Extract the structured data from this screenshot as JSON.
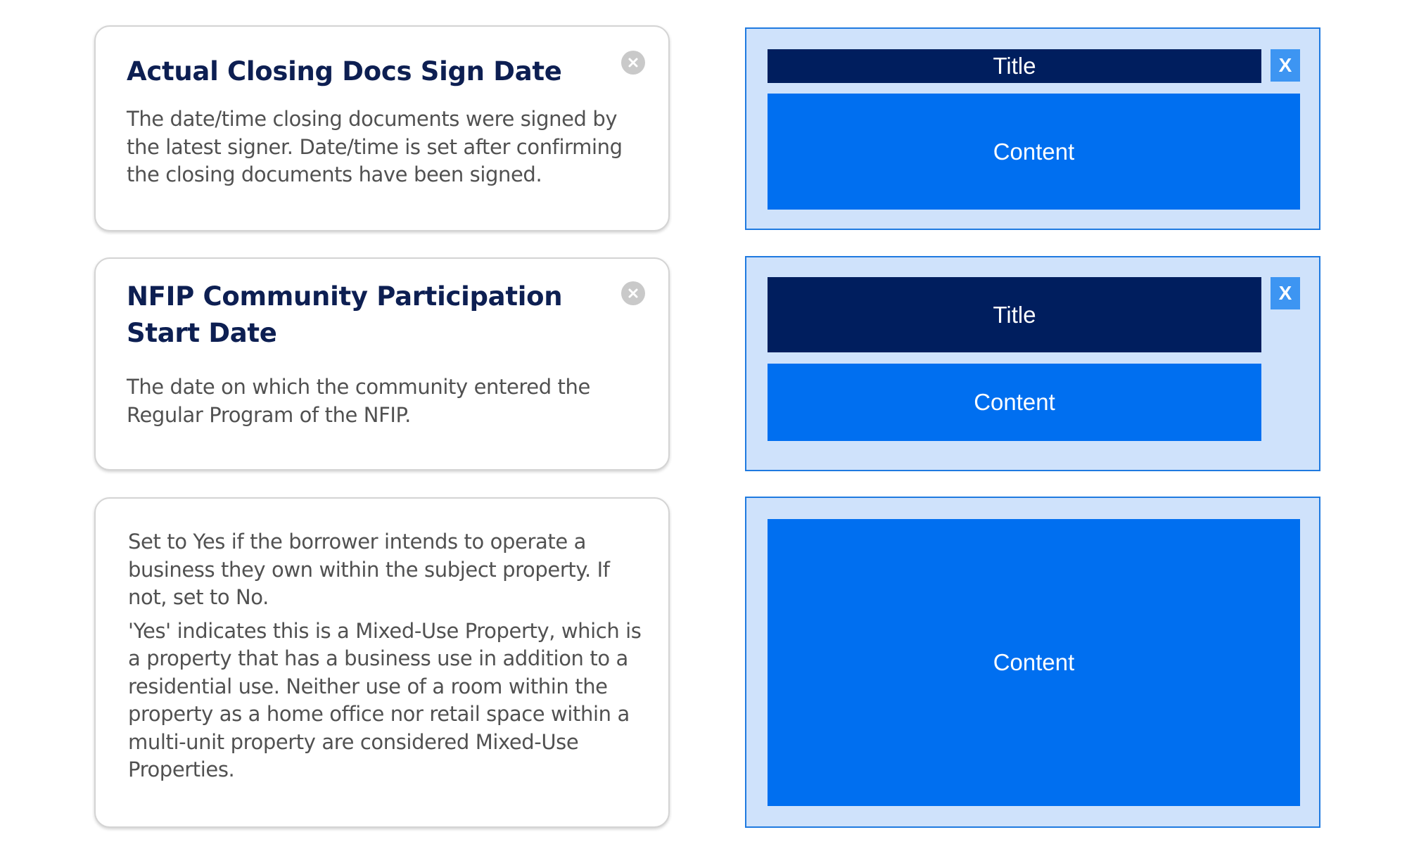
{
  "tooltips": [
    {
      "title": "Actual Closing Docs Sign Date",
      "body": "The date/time closing documents were signed by the latest signer. Date/time is set after confirming the closing documents have been signed."
    },
    {
      "title": "NFIP Community Participation Start Date",
      "body": "The date on which the community entered the Regular Program of the NFIP."
    },
    {
      "paragraph_1": "Set to Yes if the borrower intends to operate a business they own within the subject property. If not, set to No.",
      "paragraph_2": "'Yes' indicates this is a Mixed-Use Property, which is a property that has a business use in addition to a residential use. Neither use of a room within the property as a home office nor retail space within a multi-unit property are considered Mixed-Use Properties."
    }
  ],
  "wireframes": [
    {
      "title_label": "Title",
      "content_label": "Content",
      "close_label": "X"
    },
    {
      "title_label": "Title",
      "content_label": "Content",
      "close_label": "X"
    },
    {
      "content_label": "Content"
    }
  ],
  "colors": {
    "title_dark": "#001e5e",
    "content_blue": "#006ff0",
    "close_blue": "#3d95f2",
    "frame_fill": "#cfe2fb",
    "frame_border": "#1f7ae0",
    "card_title_text": "#0d1f52"
  },
  "icons": {
    "card_close": "circle-x-icon"
  }
}
